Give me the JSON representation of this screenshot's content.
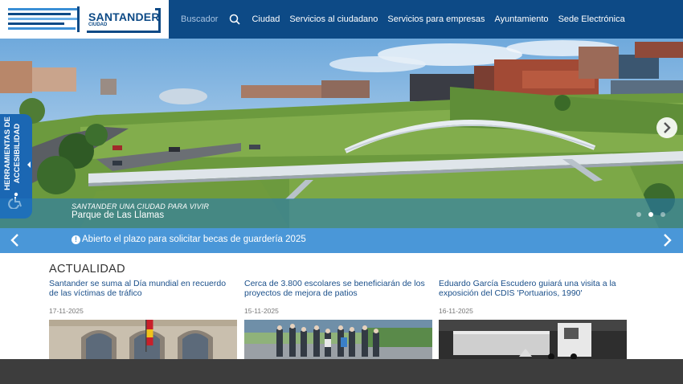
{
  "header": {
    "logo_text": "SANTANDER",
    "logo_subtext": "CIUDAD",
    "search_label": "Buscador",
    "nav_items": [
      "Ciudad",
      "Servicios al ciudadano",
      "Servicios para empresas",
      "Ayuntamiento",
      "Sede Electrónica"
    ]
  },
  "accessibility": {
    "label_line1": "HERRAMIENTAS DE",
    "label_line2": "ACCESIBILIDAD"
  },
  "hero": {
    "kicker": "SANTANDER UNA CIUDAD PARA VIVIR",
    "title": "Parque de Las Llamas",
    "slide_count": 3,
    "active_slide": 2
  },
  "notice": {
    "text": "Abierto el plazo para solicitar becas de guardería 2025"
  },
  "news": {
    "section_title": "ACTUALIDAD",
    "items": [
      {
        "title": "Santander se suma al Día mundial en recuerdo de las víctimas de tráfico",
        "date": "17-11-2025"
      },
      {
        "title": "Cerca de 3.800 escolares se beneficiarán de los proyectos de mejora de patios",
        "date": "15-11-2025"
      },
      {
        "title": "Eduardo García Escudero guiará una visita a la exposición del CDIS 'Portuarios, 1990'",
        "date": "16-11-2025"
      }
    ]
  },
  "colors": {
    "header_bg": "#0d4a86",
    "notice_bg": "#4a97d8",
    "link": "#1a4f8a",
    "footer": "#3d3d3d"
  }
}
